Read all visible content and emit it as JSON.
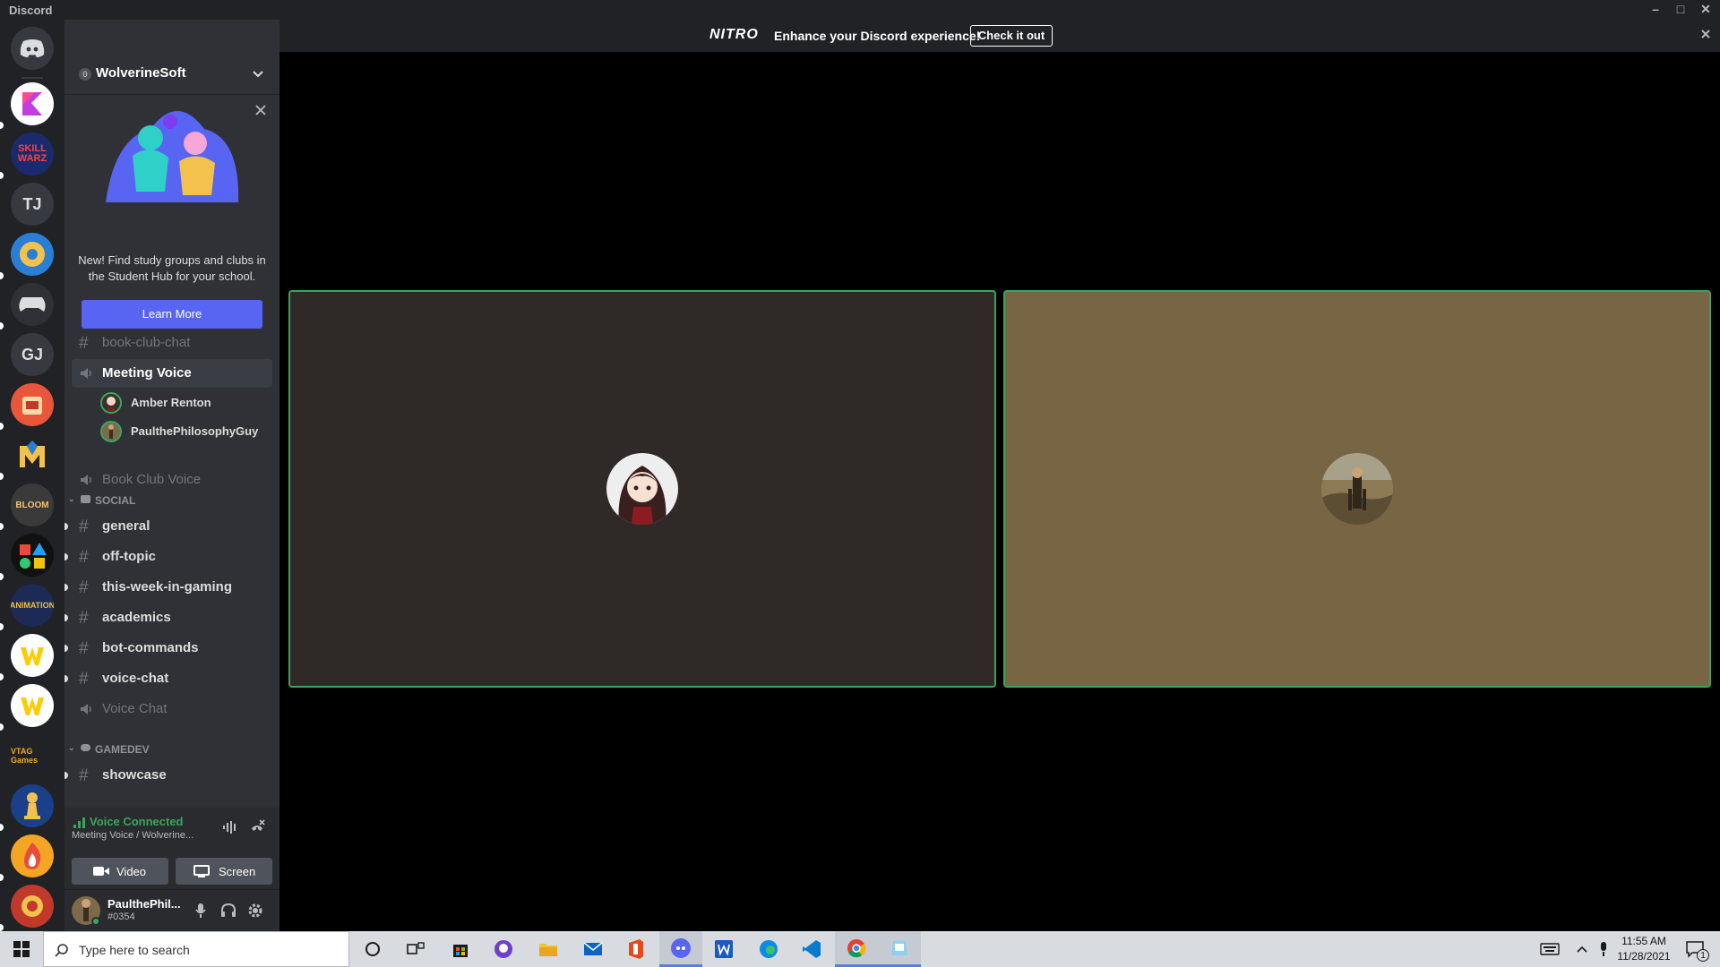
{
  "window": {
    "title": "Discord"
  },
  "servers": [
    {
      "name": "server-icon-app",
      "color": "#ffffff"
    },
    {
      "name": "server-icon-skillwarz",
      "color": "#1a2a6c"
    },
    {
      "name": "server-icon-tj",
      "label": "TJ",
      "color": "#36393f"
    },
    {
      "name": "server-icon-gear",
      "color": "#2a7fd4"
    },
    {
      "name": "server-icon-controller",
      "color": "#2f3136"
    },
    {
      "name": "server-icon-gj",
      "label": "GJ",
      "color": "#36393f"
    },
    {
      "name": "server-icon-orange",
      "color": "#e8563b"
    },
    {
      "name": "server-icon-m",
      "color": "#202225"
    },
    {
      "name": "server-icon-bloom",
      "color": "#3a3a3a"
    },
    {
      "name": "server-icon-shapes",
      "color": "#111111"
    },
    {
      "name": "server-icon-animation",
      "color": "#1c2a55"
    },
    {
      "name": "server-icon-wolverine-studio",
      "color": "#ffffff"
    },
    {
      "name": "server-icon-wolverine-studio-2",
      "color": "#ffffff"
    },
    {
      "name": "server-icon-vtag",
      "label": "VTAG Games",
      "color": "#202225"
    },
    {
      "name": "server-icon-trophy",
      "color": "#1c3f8a"
    },
    {
      "name": "server-icon-fire",
      "color": "#f4a523"
    },
    {
      "name": "server-icon-red",
      "color": "#c0392b"
    }
  ],
  "guild": {
    "name": "WolverineSoft",
    "badge": "0"
  },
  "promo": {
    "text": "New! Find study groups and clubs in the Student Hub for your school.",
    "button": "Learn More"
  },
  "channels": {
    "book_club_chat": "book-club-chat",
    "meeting_voice": "Meeting Voice",
    "voice_users": [
      "Amber Renton",
      "PaulthePhilosophyGuy"
    ],
    "book_club_voice": "Book Club Voice",
    "social_category": "SOCIAL",
    "social": [
      "general",
      "off-topic",
      "this-week-in-gaming",
      "academics",
      "bot-commands",
      "voice-chat"
    ],
    "voice_chat": "Voice Chat",
    "gamedev_category": "GAMEDEV",
    "gamedev": [
      "showcase"
    ]
  },
  "voice_panel": {
    "status": "Voice Connected",
    "subtitle": "Meeting Voice / Wolverine...",
    "video_label": "Video",
    "screen_label": "Screen"
  },
  "user": {
    "name": "PaulthePhil...",
    "tag": "#0354"
  },
  "nitro": {
    "logo": "NITRO",
    "message": "Enhance your Discord experience!",
    "cta": "Check it out"
  },
  "tiles": [
    {
      "name": "Amber Renton",
      "bg": "#2f2a27"
    },
    {
      "name": "PaulthePhilosophyGuy",
      "bg": "#776544"
    }
  ],
  "taskbar": {
    "search_placeholder": "Type here to search",
    "time": "11:55 AM",
    "date": "11/28/2021",
    "notification_count": "1"
  },
  "colors": {
    "accent": "#5865f2",
    "voice_green": "#3ba55d"
  }
}
